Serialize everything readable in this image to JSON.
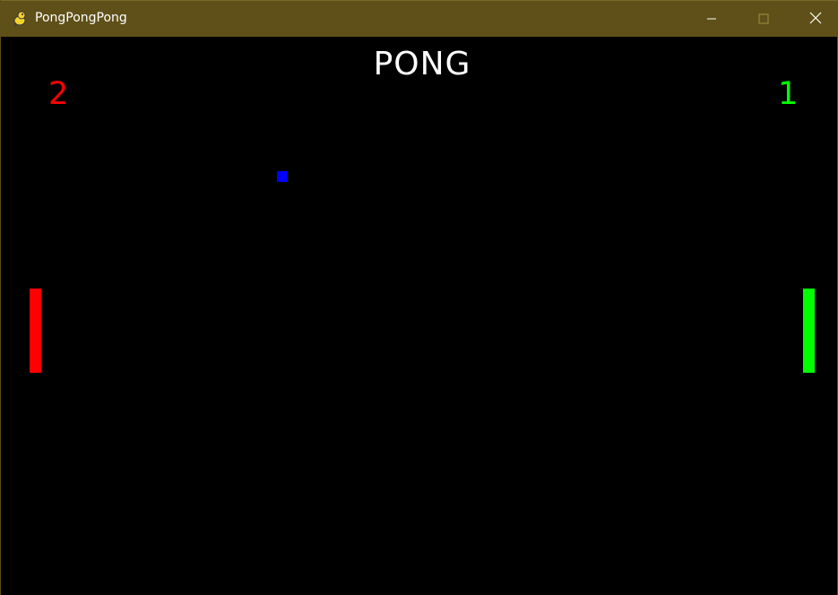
{
  "window": {
    "title": "PongPongPong",
    "titlebar_color": "#5e5018",
    "app_icon": "pygame-snake-icon",
    "controls": {
      "minimize_icon": "minimize-icon",
      "maximize_icon": "maximize-icon",
      "close_icon": "close-icon"
    }
  },
  "game": {
    "title": "PONG",
    "background": "#000000",
    "left_player": {
      "score": "2",
      "color": "#ff0000"
    },
    "right_player": {
      "score": "1",
      "color": "#00ff00"
    },
    "ball": {
      "color": "#0000ff"
    }
  }
}
